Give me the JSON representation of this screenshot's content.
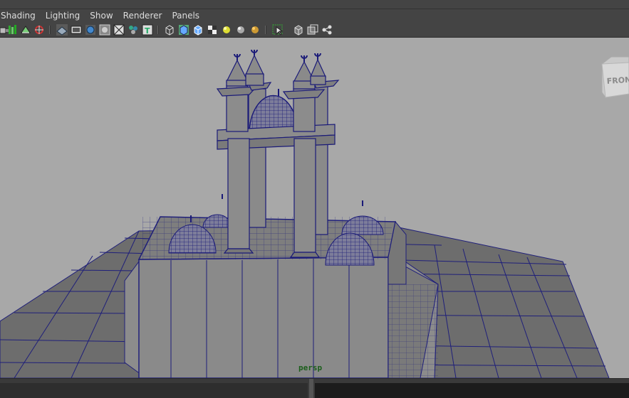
{
  "menu": {
    "items": [
      {
        "label": "Shading"
      },
      {
        "label": "Lighting"
      },
      {
        "label": "Show"
      },
      {
        "label": "Renderer"
      },
      {
        "label": "Panels"
      }
    ]
  },
  "toolbar": {
    "icons": [
      "select-camera-icon",
      "camera-attributes-icon",
      "bookmark-icon",
      "image-plane-icon",
      "grid-icon",
      "film-gate-icon",
      "resolution-gate-icon",
      "gate-mask-icon",
      "field-chart-icon",
      "safe-action-icon",
      "wireframe-icon",
      "smooth-shade-icon",
      "wireframe-on-shaded-icon",
      "textured-icon",
      "use-default-lights-icon",
      "shadows-icon",
      "high-quality-icon",
      "xray-icon",
      "isolate-select-icon",
      "two-panel-icon",
      "graph-icon"
    ]
  },
  "viewport": {
    "camera_label": "persp",
    "view_cube_label": "FRONT"
  },
  "colors": {
    "viewport_bg": "#a8a8a8",
    "wire": "#1f1f7a",
    "surface": "#8c8c8c",
    "ground": "#6e6e6e"
  }
}
